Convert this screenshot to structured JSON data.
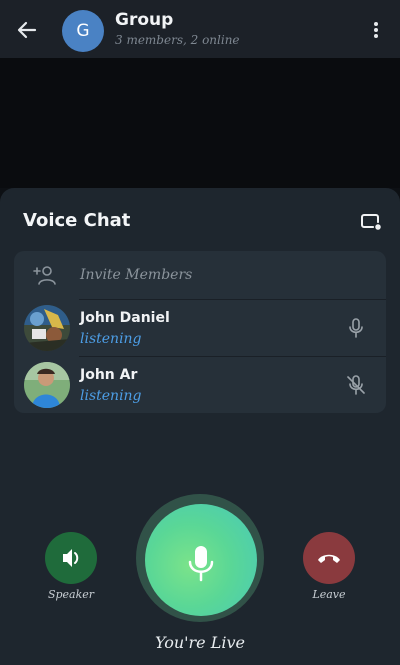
{
  "header": {
    "title": "Group",
    "subtitle": "3 members, 2 online",
    "avatar_letter": "G"
  },
  "sheet": {
    "title": "Voice Chat",
    "invite_label": "Invite Members",
    "members": [
      {
        "name": "John Daniel",
        "status": "listening",
        "mic": "mic-icon"
      },
      {
        "name": "John Ar",
        "status": "listening",
        "mic": "mic-muted-icon"
      }
    ]
  },
  "controls": {
    "speaker_label": "Speaker",
    "leave_label": "Leave",
    "live_label": "You're Live"
  },
  "colors": {
    "speaker": "#1f6b3b",
    "leave": "#8a3a3e",
    "mic_gradient_start": "#7be38a",
    "mic_gradient_end": "#48c9b9",
    "status": "#4d9ee6"
  },
  "icons": [
    "arrow-left-icon",
    "more-vertical-icon",
    "screen-share-icon",
    "add-user-icon",
    "mic-icon",
    "mic-muted-icon",
    "speaker-icon",
    "phone-hangup-icon"
  ]
}
